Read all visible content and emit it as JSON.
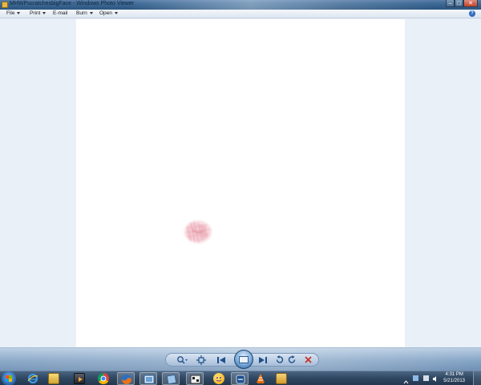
{
  "window": {
    "title": "MHWPscratchesbigFace - Windows Photo Viewer",
    "controls": [
      "minimize-icon",
      "maximize-icon",
      "close-icon"
    ]
  },
  "menu": {
    "items": [
      {
        "label": "File",
        "has_dropdown": true
      },
      {
        "label": "Print",
        "has_dropdown": true
      },
      {
        "label": "E-mail",
        "has_dropdown": false
      },
      {
        "label": "Burn",
        "has_dropdown": true
      },
      {
        "label": "Open",
        "has_dropdown": true
      }
    ],
    "help_label": "?"
  },
  "viewer": {
    "background_color": "#eaf0f8",
    "photo_color": "#ffffff",
    "mark_color": "#d9536f"
  },
  "controls": {
    "buttons": [
      "zoom-icon",
      "actual-size-icon",
      "previous-icon",
      "slideshow-icon",
      "next-icon",
      "rotate-left-icon",
      "rotate-right-icon",
      "delete-icon"
    ]
  },
  "taskbar": {
    "pinned": [
      "internet-explorer-icon",
      "windows-explorer-icon",
      "media-player-icon",
      "chrome-icon",
      "firefox-icon",
      "photo-viewer-icon",
      "app-icon",
      "game-icon",
      "messenger-icon",
      "app-icon-2",
      "vlc-icon",
      "folder-icon"
    ],
    "clock_time": "4:31 PM",
    "clock_date": "5/21/2013"
  }
}
